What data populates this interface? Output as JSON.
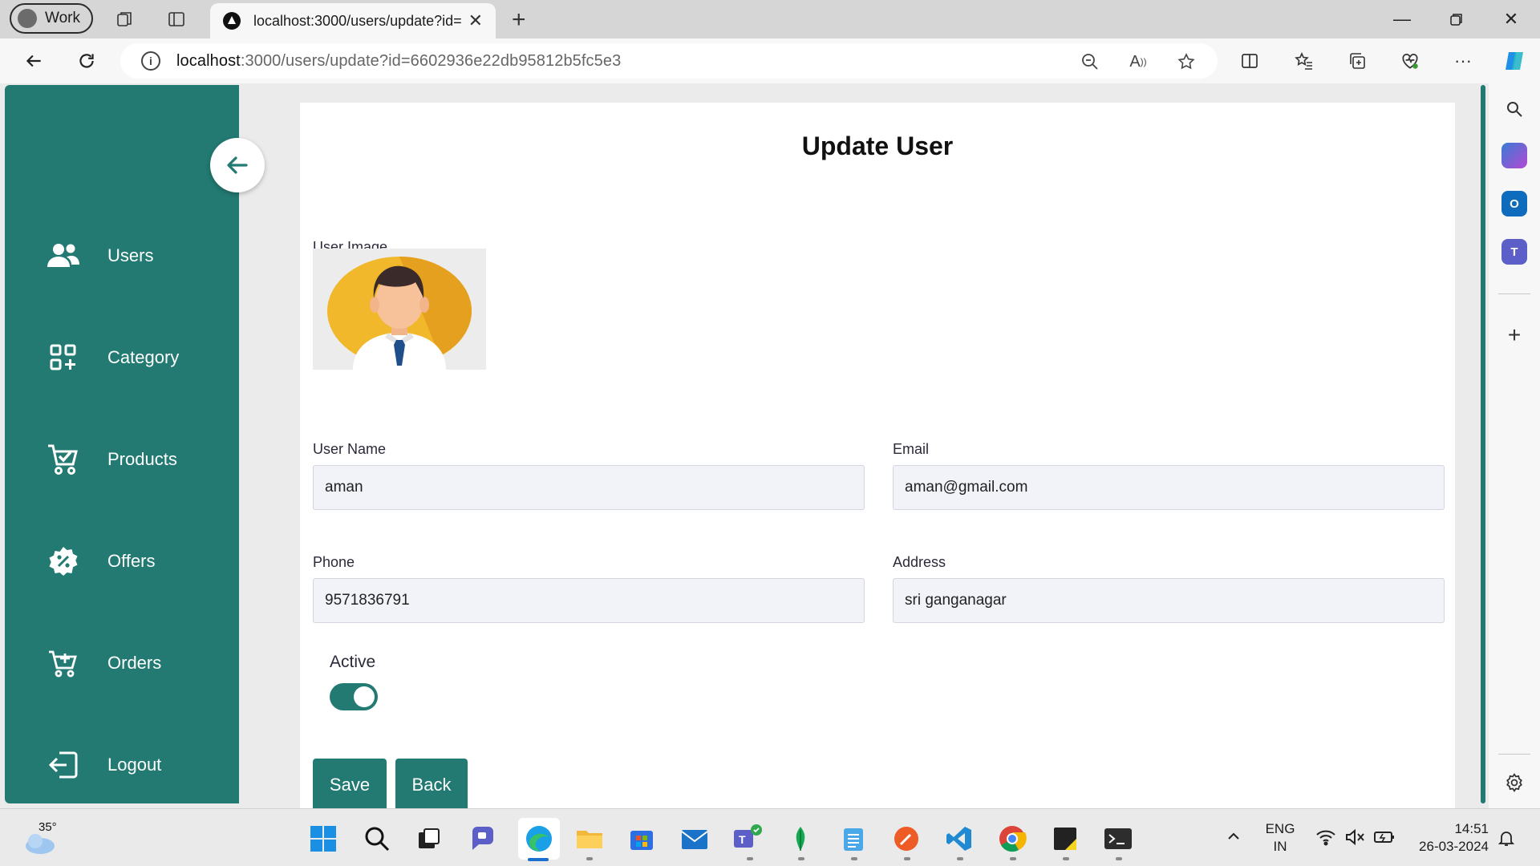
{
  "browser": {
    "profile_label": "Work",
    "tab_title": "localhost:3000/users/update?id=",
    "url_host": "localhost",
    "url_rest": ":3000/users/update?id=6602936e22db95812b5fc5e3"
  },
  "sidebar": {
    "items": [
      {
        "label": "Users",
        "icon": "users-icon"
      },
      {
        "label": "Category",
        "icon": "category-icon"
      },
      {
        "label": "Products",
        "icon": "cart-check-icon"
      },
      {
        "label": "Offers",
        "icon": "offer-badge-icon"
      },
      {
        "label": "Orders",
        "icon": "cart-plus-icon"
      },
      {
        "label": "Logout",
        "icon": "logout-icon"
      }
    ]
  },
  "form": {
    "title": "Update User",
    "image_label": "User Image",
    "username_label": "User Name",
    "username_value": "aman",
    "email_label": "Email",
    "email_value": "aman@gmail.com",
    "phone_label": "Phone",
    "phone_value": "9571836791",
    "address_label": "Address",
    "address_value": "sri ganganagar",
    "active_label": "Active",
    "active_value": true,
    "save_label": "Save",
    "back_label": "Back"
  },
  "taskbar": {
    "weather_temp": "35°",
    "lang_top": "ENG",
    "lang_bottom": "IN",
    "time": "14:51",
    "date": "26-03-2024"
  },
  "colors": {
    "accent": "#227a72",
    "field_bg": "#f1f3f8"
  }
}
